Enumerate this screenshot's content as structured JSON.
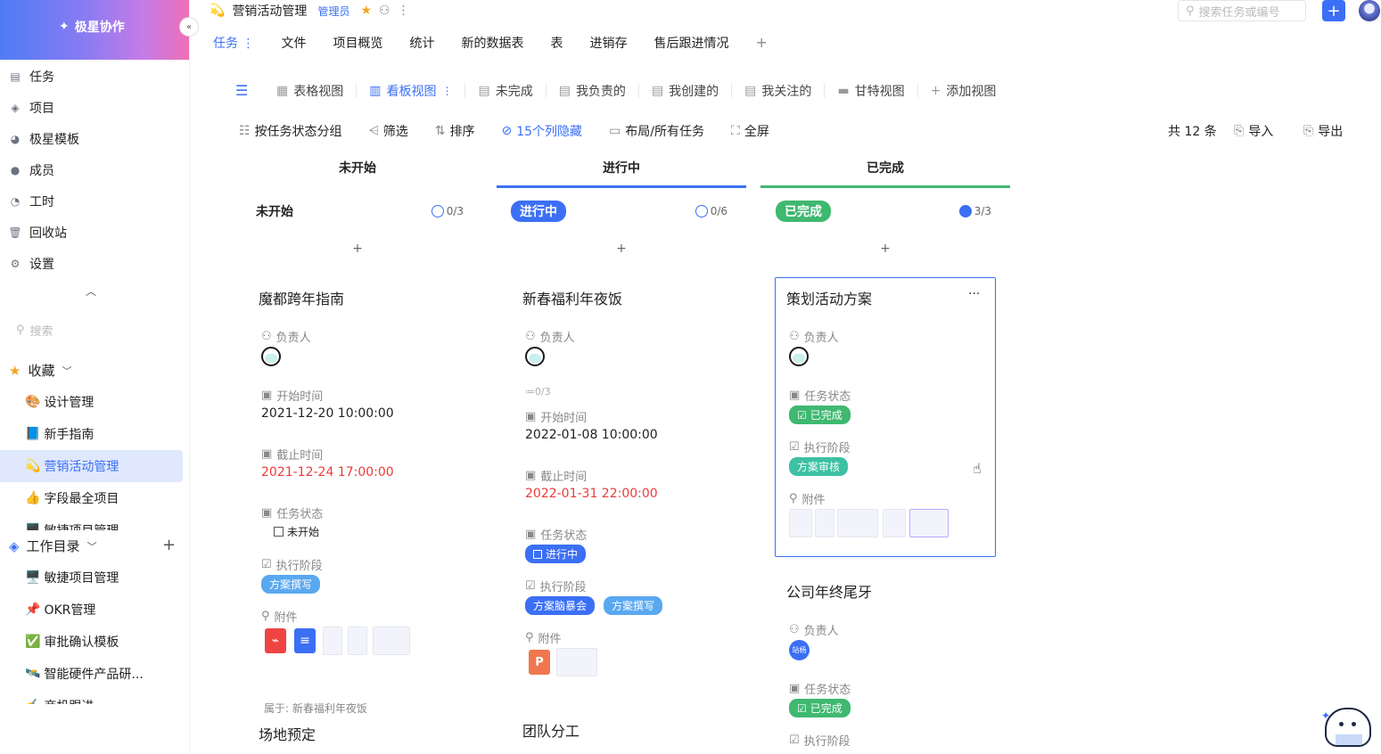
{
  "app": {
    "name": "极星协作"
  },
  "sidebar": {
    "nav": [
      {
        "label": "任务",
        "icon": "task-icon"
      },
      {
        "label": "项目",
        "icon": "layers-icon"
      },
      {
        "label": "极星模板",
        "icon": "template-icon"
      },
      {
        "label": "成员",
        "icon": "user-icon"
      },
      {
        "label": "工时",
        "icon": "clock-icon"
      },
      {
        "label": "回收站",
        "icon": "trash-icon"
      },
      {
        "label": "设置",
        "icon": "settings-icon"
      }
    ],
    "search_placeholder": "搜索",
    "favorites_label": "收藏",
    "favorites": [
      {
        "label": "设计管理",
        "emoji": "🎨"
      },
      {
        "label": "新手指南",
        "emoji": "📘"
      },
      {
        "label": "营销活动管理",
        "emoji": "💫"
      },
      {
        "label": "字段最全项目",
        "emoji": "👍"
      },
      {
        "label": "敏捷项目管理",
        "emoji": "🖥️"
      }
    ],
    "workdir_label": "工作目录",
    "workdir": [
      {
        "label": "敏捷项目管理",
        "emoji": "🖥️"
      },
      {
        "label": "OKR管理",
        "emoji": "📌"
      },
      {
        "label": "审批确认模板",
        "emoji": "✅"
      },
      {
        "label": "智能硬件产品研...",
        "emoji": "🛰️"
      },
      {
        "label": "商机跟进",
        "emoji": "✍️"
      }
    ]
  },
  "header": {
    "project_title": "营销活动管理",
    "project_emoji": "💫",
    "role_badge": "管理员",
    "tabs": [
      "任务",
      "文件",
      "项目概览",
      "统计",
      "新的数据表",
      "表",
      "进销存",
      "售后跟进情况"
    ],
    "add_tab": "+",
    "search_placeholder": "搜索任务或编号",
    "add_button": "+"
  },
  "views": [
    {
      "label": "表格视图"
    },
    {
      "label": "看板视图",
      "active": true
    },
    {
      "label": "未完成"
    },
    {
      "label": "我负责的"
    },
    {
      "label": "我创建的"
    },
    {
      "label": "我关注的"
    },
    {
      "label": "甘特视图"
    },
    {
      "label": "添加视图"
    }
  ],
  "toolbar": {
    "group_by": "按任务状态分组",
    "filter": "筛选",
    "sort": "排序",
    "hidden_cols": "15个列隐藏",
    "layout": "布局/所有任务",
    "fullscreen": "全屏",
    "total": "共 12 条",
    "import": "导入",
    "export": "导出"
  },
  "columns": [
    {
      "header": "未开始",
      "group": "未开始",
      "count": "0/3",
      "color": "#999999"
    },
    {
      "header": "进行中",
      "group": "进行中",
      "count": "0/6",
      "color": "#3b6ff5"
    },
    {
      "header": "已完成",
      "group": "已完成",
      "count": "3/3",
      "color": "#3fb870"
    }
  ],
  "add_card": "+",
  "labels": {
    "owner": "负责人",
    "start": "开始时间",
    "due": "截止时间",
    "status": "任务状态",
    "stage": "执行阶段",
    "attachment": "附件",
    "belongs": "属于:"
  },
  "cards": {
    "c1": {
      "title": "魔都跨年指南",
      "start": "2021-12-20 10:00:00",
      "due": "2021-12-24 17:00:00",
      "status": "未开始",
      "stage": "方案撰写"
    },
    "c2": {
      "title": "新春福利年夜饭",
      "subtasks": "0/3",
      "start": "2022-01-08 10:00:00",
      "due": "2022-01-31 22:00:00",
      "status": "进行中",
      "stage1": "方案脑暴会",
      "stage2": "方案撰写"
    },
    "c3": {
      "title": "策划活动方案",
      "status": "已完成",
      "stage": "方案审核",
      "more": "···"
    },
    "c4": {
      "title": "公司年终尾牙",
      "owner_name": "站杨",
      "status": "已完成"
    },
    "c5": {
      "parent": "新春福利年夜饭",
      "title": "场地预定"
    },
    "c6": {
      "title": "团队分工"
    }
  }
}
